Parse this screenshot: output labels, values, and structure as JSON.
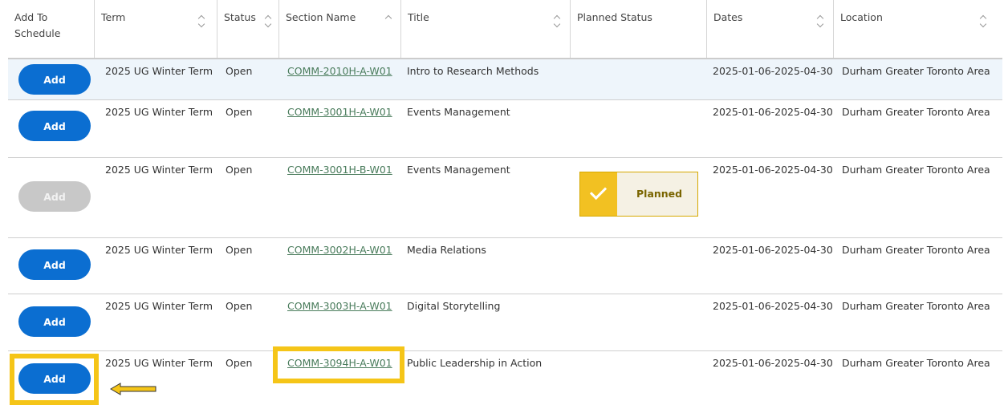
{
  "headers": [
    {
      "label": "Add To Schedule"
    },
    {
      "label": "Term"
    },
    {
      "label": "Status"
    },
    {
      "label": "Section Name"
    },
    {
      "label": "Title"
    },
    {
      "label": "Planned Status"
    },
    {
      "label": "Dates"
    },
    {
      "label": "Location"
    }
  ],
  "rows": [
    {
      "add": "Add",
      "term": "2025 UG Winter Term",
      "status": "Open",
      "section": "COMM-2010H-A-W01",
      "title": "Intro to Research Methods",
      "planned": "",
      "dates": "2025-01-06-2025-04-30",
      "location": "Durham Greater Toronto Area"
    },
    {
      "add": "Add",
      "term": "2025 UG Winter Term",
      "status": "Open",
      "section": "COMM-3001H-A-W01",
      "title": "Events Management",
      "planned": "",
      "dates": "2025-01-06-2025-04-30",
      "location": "Durham Greater Toronto Area"
    },
    {
      "add": "Add",
      "term": "2025 UG Winter Term",
      "status": "Open",
      "section": "COMM-3001H-B-W01",
      "title": "Events Management",
      "planned": "Planned",
      "dates": "2025-01-06-2025-04-30",
      "location": "Durham Greater Toronto Area"
    },
    {
      "add": "Add",
      "term": "2025 UG Winter Term",
      "status": "Open",
      "section": "COMM-3002H-A-W01",
      "title": "Media Relations",
      "planned": "",
      "dates": "2025-01-06-2025-04-30",
      "location": "Durham Greater Toronto Area"
    },
    {
      "add": "Add",
      "term": "2025 UG Winter Term",
      "status": "Open",
      "section": "COMM-3003H-A-W01",
      "title": "Digital Storytelling",
      "planned": "",
      "dates": "2025-01-06-2025-04-30",
      "location": "Durham Greater Toronto Area"
    },
    {
      "add": "Add",
      "term": "2025 UG Winter Term",
      "status": "Open",
      "section": "COMM-3094H-A-W01",
      "title": "Public Leadership in Action",
      "planned": "",
      "dates": "2025-01-06-2025-04-30",
      "location": "Durham Greater Toronto Area"
    }
  ],
  "colors": {
    "add_button": "#0b6ed1",
    "highlight": "#f5c518",
    "planned_check": "#f2c122"
  },
  "icons": {
    "planned": "checkmark-icon",
    "annotation": "left-arrow-icon"
  }
}
